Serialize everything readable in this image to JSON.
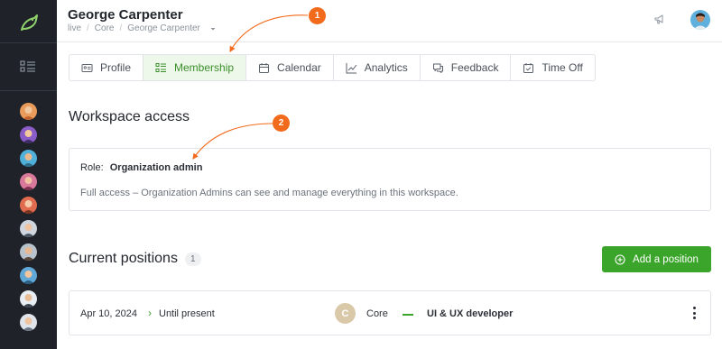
{
  "header": {
    "user_name": "George Carpenter",
    "breadcrumb": [
      "live",
      "Core",
      "George Carpenter"
    ]
  },
  "tabs": [
    {
      "label": "Profile",
      "icon": "id-card-icon",
      "active": false
    },
    {
      "label": "Membership",
      "icon": "list-icon",
      "active": true
    },
    {
      "label": "Calendar",
      "icon": "calendar-icon",
      "active": false
    },
    {
      "label": "Analytics",
      "icon": "chart-line-icon",
      "active": false
    },
    {
      "label": "Feedback",
      "icon": "chat-icon",
      "active": false
    },
    {
      "label": "Time Off",
      "icon": "calendar-check-icon",
      "active": false
    }
  ],
  "workspace": {
    "title": "Workspace access",
    "role_label": "Role:",
    "role_value": "Organization admin",
    "description": "Full access – Organization Admins can see and manage everything in this workspace."
  },
  "positions": {
    "title": "Current positions",
    "count": "1",
    "add_label": "Add a position",
    "rows": [
      {
        "start": "Apr 10, 2024",
        "end": "Until present",
        "team_initial": "C",
        "team": "Core",
        "job": "UI & UX developer"
      }
    ]
  },
  "annotations": {
    "first": "1",
    "second": "2"
  },
  "colors": {
    "accent": "#3aa52a",
    "callout": "#f26a1b",
    "sidebar": "#1f2329"
  }
}
